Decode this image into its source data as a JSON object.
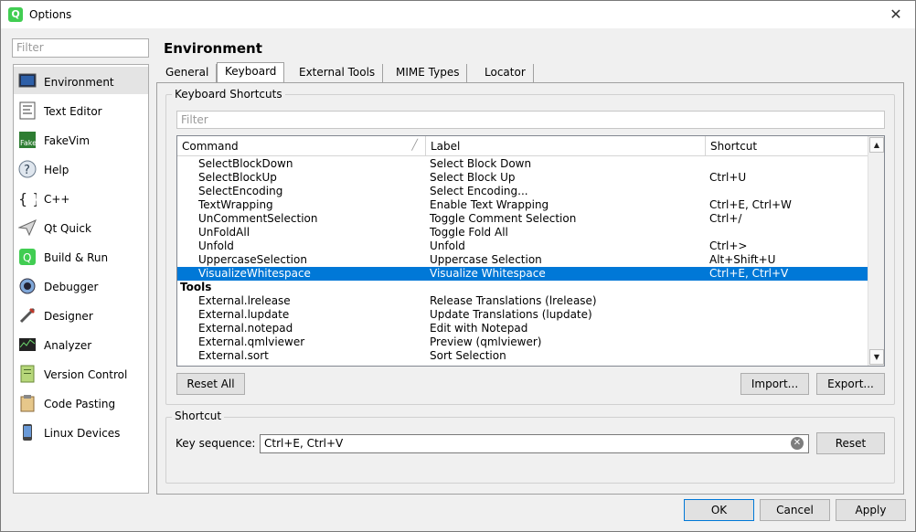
{
  "window": {
    "title": "Options",
    "close": "✕"
  },
  "left": {
    "filter_placeholder": "Filter",
    "categories": [
      {
        "label": "Environment",
        "icon": "monitor-icon"
      },
      {
        "label": "Text Editor",
        "icon": "text-editor-icon"
      },
      {
        "label": "FakeVim",
        "icon": "fakevim-icon"
      },
      {
        "label": "Help",
        "icon": "help-icon"
      },
      {
        "label": "C++",
        "icon": "cpp-braces-icon"
      },
      {
        "label": "Qt Quick",
        "icon": "qt-quick-icon"
      },
      {
        "label": "Build & Run",
        "icon": "build-run-icon"
      },
      {
        "label": "Debugger",
        "icon": "debugger-icon"
      },
      {
        "label": "Designer",
        "icon": "designer-icon"
      },
      {
        "label": "Analyzer",
        "icon": "analyzer-icon"
      },
      {
        "label": "Version Control",
        "icon": "version-control-icon"
      },
      {
        "label": "Code Pasting",
        "icon": "code-pasting-icon"
      },
      {
        "label": "Linux Devices",
        "icon": "linux-devices-icon"
      }
    ]
  },
  "main": {
    "title": "Environment",
    "tabs": [
      "General",
      "Keyboard",
      "External Tools",
      "MIME Types",
      "Locator"
    ],
    "active_tab": "Keyboard",
    "shortcuts_group": "Keyboard Shortcuts",
    "filter_placeholder": "Filter",
    "columns": [
      "Command",
      "Label",
      "Shortcut"
    ],
    "rows": [
      {
        "command": "SelectBlockDown",
        "label": "Select Block Down",
        "shortcut": ""
      },
      {
        "command": "SelectBlockUp",
        "label": "Select Block Up",
        "shortcut": "Ctrl+U"
      },
      {
        "command": "SelectEncoding",
        "label": "Select Encoding...",
        "shortcut": ""
      },
      {
        "command": "TextWrapping",
        "label": "Enable Text Wrapping",
        "shortcut": "Ctrl+E, Ctrl+W"
      },
      {
        "command": "UnCommentSelection",
        "label": "Toggle Comment Selection",
        "shortcut": "Ctrl+/"
      },
      {
        "command": "UnFoldAll",
        "label": "Toggle Fold All",
        "shortcut": ""
      },
      {
        "command": "Unfold",
        "label": "Unfold",
        "shortcut": "Ctrl+>"
      },
      {
        "command": "UppercaseSelection",
        "label": "Uppercase Selection",
        "shortcut": "Alt+Shift+U"
      },
      {
        "command": "VisualizeWhitespace",
        "label": "Visualize Whitespace",
        "shortcut": "Ctrl+E, Ctrl+V",
        "selected": true
      },
      {
        "command": "Tools",
        "label": "",
        "shortcut": "",
        "group": true
      },
      {
        "command": "External.lrelease",
        "label": "Release Translations (lrelease)",
        "shortcut": ""
      },
      {
        "command": "External.lupdate",
        "label": "Update Translations (lupdate)",
        "shortcut": ""
      },
      {
        "command": "External.notepad",
        "label": "Edit with Notepad",
        "shortcut": ""
      },
      {
        "command": "External.qmlviewer",
        "label": "Preview (qmlviewer)",
        "shortcut": ""
      },
      {
        "command": "External.sort",
        "label": "Sort Selection",
        "shortcut": ""
      }
    ],
    "buttons": {
      "reset_all": "Reset All",
      "import": "Import...",
      "export": "Export..."
    },
    "shortcut_group": "Shortcut",
    "key_sequence_label": "Key sequence:",
    "key_sequence_value": "Ctrl+E, Ctrl+V",
    "reset": "Reset"
  },
  "footer": {
    "ok": "OK",
    "cancel": "Cancel",
    "apply": "Apply"
  },
  "colors": {
    "selection": "#0078d7",
    "qt_green": "#41cd52"
  }
}
